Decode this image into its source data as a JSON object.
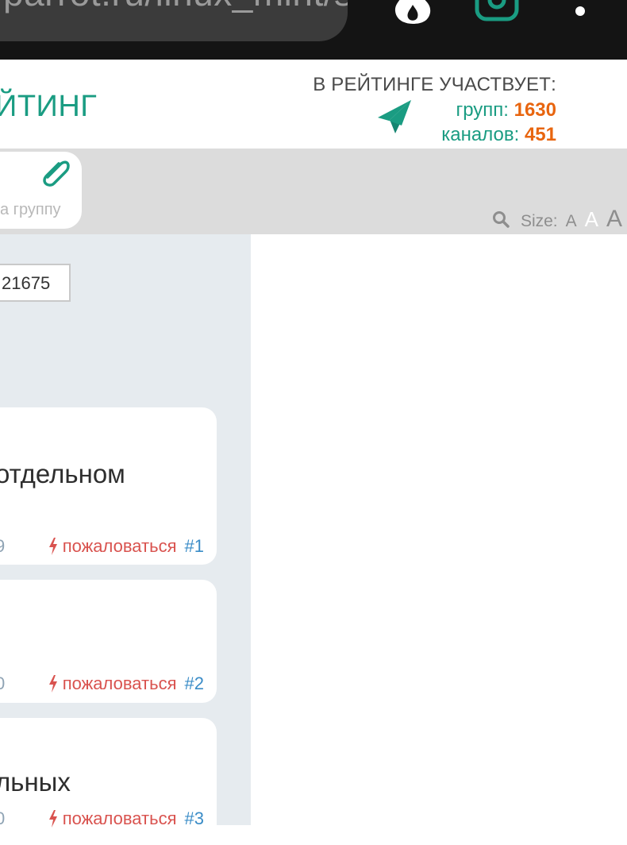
{
  "browser": {
    "url": "parrot.ru/linux_mint/s",
    "icons": [
      "fire-icon",
      "instagram-icon",
      "more-vert-icon"
    ]
  },
  "header": {
    "title": "ЙТИНГ",
    "rating_label": "В РЕЙТИНГЕ УЧАСТВУЕТ:",
    "groups_label": "групп: ",
    "groups_count": "1630",
    "channels_label": "каналов: ",
    "channels_count": "451",
    "accent_color": "#1a9c82",
    "count_color": "#e8650f"
  },
  "toolbar": {
    "add_group_text": "а группу",
    "size_label": "Size:",
    "size_options": [
      "A",
      "A",
      "A"
    ]
  },
  "content": {
    "id_value": "21675",
    "posts": [
      {
        "text": "отдельном",
        "meta_num": "9",
        "complain": "пожаловаться",
        "post_number": "#1"
      },
      {
        "text": "",
        "meta_num": "0",
        "complain": "пожаловаться",
        "post_number": "#2"
      },
      {
        "text": "льных",
        "meta_num": "0",
        "complain": "пожаловаться",
        "post_number": "#3"
      }
    ]
  }
}
